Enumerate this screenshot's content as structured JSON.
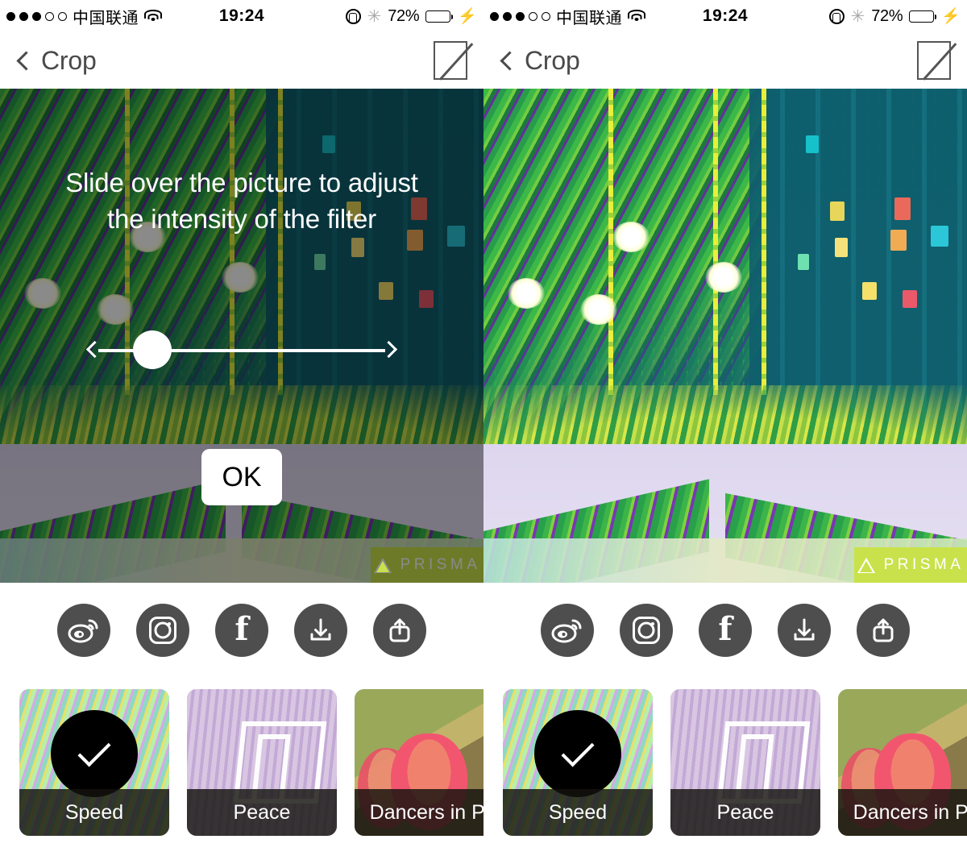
{
  "app": "Prisma photo filter app",
  "status_bar": {
    "signal_dots_total": 5,
    "signal_dots_filled": 3,
    "carrier": "中国联通",
    "wifi_icon": "wifi-icon",
    "time": "19:24",
    "rotation_lock_icon": "rotation-lock-icon",
    "bluetooth_icon": "bluetooth-icon",
    "bluetooth_glyph": "✳",
    "battery_percent": "72%",
    "battery_level": 72,
    "charging_icon": "⚡",
    "battery_color": "#4cd964"
  },
  "nav_bar": {
    "back_icon": "chevron-left-icon",
    "title": "Crop",
    "crop_icon": "crop-aspect-icon",
    "title_color": "#4a4a4a"
  },
  "photo": {
    "watermark": "PRISMA",
    "watermark_bg": "#c9e24b",
    "watermark_logo": "triangle-logo"
  },
  "overlay": {
    "hint_line1": "Slide over the picture to adjust",
    "hint_line2": "the intensity of the filter",
    "slider_name": "intensity-slider",
    "slider_value_position_pct": 16,
    "ok_label": "OK"
  },
  "share": {
    "items": [
      {
        "name": "weibo",
        "icon": "weibo-icon",
        "glyph": "◉"
      },
      {
        "name": "instagram",
        "icon": "instagram-icon",
        "glyph": ""
      },
      {
        "name": "facebook",
        "icon": "facebook-icon",
        "glyph": "f"
      },
      {
        "name": "download",
        "icon": "download-icon",
        "glyph": "↓"
      },
      {
        "name": "share",
        "icon": "share-icon",
        "glyph": "↑"
      }
    ],
    "button_color": "#4e4e4e"
  },
  "filters": {
    "items": [
      {
        "label": "Speed",
        "selected": true,
        "check_icon": "check-icon"
      },
      {
        "label": "Peace",
        "selected": false,
        "check_icon": ""
      },
      {
        "label": "Dancers in Pi",
        "selected": false,
        "check_icon": ""
      }
    ]
  },
  "panels": [
    {
      "id": "left",
      "show_overlay": true
    },
    {
      "id": "right",
      "show_overlay": false
    }
  ]
}
